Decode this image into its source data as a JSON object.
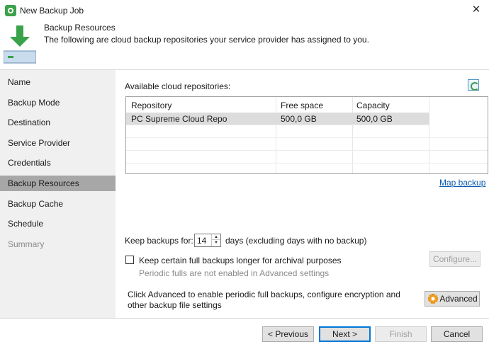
{
  "window": {
    "title": "New Backup Job",
    "close_glyph": "✕"
  },
  "header": {
    "title": "Backup Resources",
    "description": "The following are cloud backup repositories your service provider has assigned to you."
  },
  "sidebar": {
    "items": [
      {
        "label": "Name",
        "state": "normal"
      },
      {
        "label": "Backup Mode",
        "state": "normal"
      },
      {
        "label": "Destination",
        "state": "normal"
      },
      {
        "label": "Service Provider",
        "state": "normal"
      },
      {
        "label": "Credentials",
        "state": "normal"
      },
      {
        "label": "Backup Resources",
        "state": "active"
      },
      {
        "label": "Backup Cache",
        "state": "normal"
      },
      {
        "label": "Schedule",
        "state": "normal"
      },
      {
        "label": "Summary",
        "state": "disabled"
      }
    ]
  },
  "main": {
    "repos_label": "Available cloud repositories:",
    "grid": {
      "columns": [
        "Repository",
        "Free space",
        "Capacity"
      ],
      "rows": [
        {
          "repository": "PC Supreme Cloud Repo",
          "free_space": "500,0 GB",
          "capacity": "500,0 GB"
        }
      ]
    },
    "map_backup_link": "Map backup",
    "keep_label": "Keep backups for:",
    "keep_value": "14",
    "keep_suffix": "days (excluding days with no backup)",
    "archive_checkbox_label": "Keep certain full backups longer for archival purposes",
    "archive_hint": "Periodic fulls are not enabled in Advanced settings",
    "configure_button": "Configure...",
    "advanced_text": "Click Advanced to enable periodic full backups, configure encryption and other backup file settings",
    "advanced_button": "Advanced"
  },
  "footer": {
    "previous": "< Previous",
    "next": "Next >",
    "finish": "Finish",
    "cancel": "Cancel"
  },
  "icons": {
    "app": "veeam-gear-icon",
    "header": "download-arrow-icon",
    "refresh": "refresh-icon",
    "advanced": "gear-icon"
  },
  "colors": {
    "active_nav": "#a7a7a7",
    "sidebar_bg": "#f0f0f0",
    "link": "#0b5cad",
    "accent": "#0078d7"
  }
}
